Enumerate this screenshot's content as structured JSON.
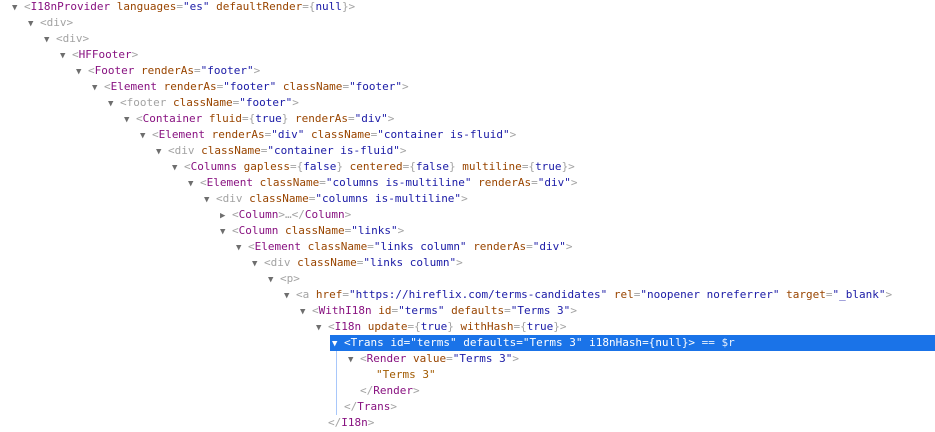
{
  "tree": {
    "rows": [
      {
        "depth": 0,
        "twisty": "▼",
        "parts": [
          [
            "p",
            "<"
          ],
          [
            "tn",
            "I18nProvider"
          ],
          [
            "p",
            " "
          ],
          [
            "an",
            "languages"
          ],
          [
            "p",
            "="
          ],
          [
            "av",
            "\"es\""
          ],
          [
            "p",
            " "
          ],
          [
            "an",
            "defaultRender"
          ],
          [
            "p",
            "={"
          ],
          [
            "av",
            "null"
          ],
          [
            "p",
            "}>"
          ]
        ]
      },
      {
        "depth": 1,
        "twisty": "▼",
        "parts": [
          [
            "p",
            "<div>"
          ]
        ]
      },
      {
        "depth": 2,
        "twisty": "▼",
        "parts": [
          [
            "p",
            "<div>"
          ]
        ]
      },
      {
        "depth": 3,
        "twisty": "▼",
        "parts": [
          [
            "p",
            "<"
          ],
          [
            "tn",
            "HFFooter"
          ],
          [
            "p",
            ">"
          ]
        ]
      },
      {
        "depth": 4,
        "twisty": "▼",
        "parts": [
          [
            "p",
            "<"
          ],
          [
            "tn",
            "Footer"
          ],
          [
            "p",
            " "
          ],
          [
            "an",
            "renderAs"
          ],
          [
            "p",
            "="
          ],
          [
            "av",
            "\"footer\""
          ],
          [
            "p",
            ">"
          ]
        ]
      },
      {
        "depth": 5,
        "twisty": "▼",
        "parts": [
          [
            "p",
            "<"
          ],
          [
            "tn",
            "Element"
          ],
          [
            "p",
            " "
          ],
          [
            "an",
            "renderAs"
          ],
          [
            "p",
            "="
          ],
          [
            "av",
            "\"footer\""
          ],
          [
            "p",
            " "
          ],
          [
            "an",
            "className"
          ],
          [
            "p",
            "="
          ],
          [
            "av",
            "\"footer\""
          ],
          [
            "p",
            ">"
          ]
        ]
      },
      {
        "depth": 6,
        "twisty": "▼",
        "parts": [
          [
            "p",
            "<footer"
          ],
          [
            "p",
            " "
          ],
          [
            "an",
            "className"
          ],
          [
            "p",
            "="
          ],
          [
            "av",
            "\"footer\""
          ],
          [
            "p",
            ">"
          ]
        ]
      },
      {
        "depth": 7,
        "twisty": "▼",
        "parts": [
          [
            "p",
            "<"
          ],
          [
            "tn",
            "Container"
          ],
          [
            "p",
            " "
          ],
          [
            "an",
            "fluid"
          ],
          [
            "p",
            "={"
          ],
          [
            "av",
            "true"
          ],
          [
            "p",
            "} "
          ],
          [
            "an",
            "renderAs"
          ],
          [
            "p",
            "="
          ],
          [
            "av",
            "\"div\""
          ],
          [
            "p",
            ">"
          ]
        ]
      },
      {
        "depth": 8,
        "twisty": "▼",
        "parts": [
          [
            "p",
            "<"
          ],
          [
            "tn",
            "Element"
          ],
          [
            "p",
            " "
          ],
          [
            "an",
            "renderAs"
          ],
          [
            "p",
            "="
          ],
          [
            "av",
            "\"div\""
          ],
          [
            "p",
            " "
          ],
          [
            "an",
            "className"
          ],
          [
            "p",
            "="
          ],
          [
            "av",
            "\"container is-fluid\""
          ],
          [
            "p",
            ">"
          ]
        ]
      },
      {
        "depth": 9,
        "twisty": "▼",
        "parts": [
          [
            "p",
            "<div"
          ],
          [
            "p",
            " "
          ],
          [
            "an",
            "className"
          ],
          [
            "p",
            "="
          ],
          [
            "av",
            "\"container is-fluid\""
          ],
          [
            "p",
            ">"
          ]
        ]
      },
      {
        "depth": 10,
        "twisty": "▼",
        "parts": [
          [
            "p",
            "<"
          ],
          [
            "tn",
            "Columns"
          ],
          [
            "p",
            " "
          ],
          [
            "an",
            "gapless"
          ],
          [
            "p",
            "={"
          ],
          [
            "av",
            "false"
          ],
          [
            "p",
            "} "
          ],
          [
            "an",
            "centered"
          ],
          [
            "p",
            "={"
          ],
          [
            "av",
            "false"
          ],
          [
            "p",
            "} "
          ],
          [
            "an",
            "multiline"
          ],
          [
            "p",
            "={"
          ],
          [
            "av",
            "true"
          ],
          [
            "p",
            "}>"
          ]
        ]
      },
      {
        "depth": 11,
        "twisty": "▼",
        "parts": [
          [
            "p",
            "<"
          ],
          [
            "tn",
            "Element"
          ],
          [
            "p",
            " "
          ],
          [
            "an",
            "className"
          ],
          [
            "p",
            "="
          ],
          [
            "av",
            "\"columns is-multiline\""
          ],
          [
            "p",
            " "
          ],
          [
            "an",
            "renderAs"
          ],
          [
            "p",
            "="
          ],
          [
            "av",
            "\"div\""
          ],
          [
            "p",
            ">"
          ]
        ]
      },
      {
        "depth": 12,
        "twisty": "▼",
        "parts": [
          [
            "p",
            "<div"
          ],
          [
            "p",
            " "
          ],
          [
            "an",
            "className"
          ],
          [
            "p",
            "="
          ],
          [
            "av",
            "\"columns is-multiline\""
          ],
          [
            "p",
            ">"
          ]
        ]
      },
      {
        "depth": 13,
        "twisty": "▶",
        "parts": [
          [
            "p",
            "<"
          ],
          [
            "tn",
            "Column"
          ],
          [
            "p",
            ">…</"
          ],
          [
            "tn",
            "Column"
          ],
          [
            "p",
            ">"
          ]
        ]
      },
      {
        "depth": 13,
        "twisty": "▼",
        "parts": [
          [
            "p",
            "<"
          ],
          [
            "tn",
            "Column"
          ],
          [
            "p",
            " "
          ],
          [
            "an",
            "className"
          ],
          [
            "p",
            "="
          ],
          [
            "av",
            "\"links\""
          ],
          [
            "p",
            ">"
          ]
        ]
      },
      {
        "depth": 14,
        "twisty": "▼",
        "parts": [
          [
            "p",
            "<"
          ],
          [
            "tn",
            "Element"
          ],
          [
            "p",
            " "
          ],
          [
            "an",
            "className"
          ],
          [
            "p",
            "="
          ],
          [
            "av",
            "\"links column\""
          ],
          [
            "p",
            " "
          ],
          [
            "an",
            "renderAs"
          ],
          [
            "p",
            "="
          ],
          [
            "av",
            "\"div\""
          ],
          [
            "p",
            ">"
          ]
        ]
      },
      {
        "depth": 15,
        "twisty": "▼",
        "parts": [
          [
            "p",
            "<div"
          ],
          [
            "p",
            " "
          ],
          [
            "an",
            "className"
          ],
          [
            "p",
            "="
          ],
          [
            "av",
            "\"links column\""
          ],
          [
            "p",
            ">"
          ]
        ]
      },
      {
        "depth": 16,
        "twisty": "▼",
        "parts": [
          [
            "p",
            "<p>"
          ]
        ]
      },
      {
        "depth": 17,
        "twisty": "▼",
        "parts": [
          [
            "p",
            "<a"
          ],
          [
            "p",
            " "
          ],
          [
            "an",
            "href"
          ],
          [
            "p",
            "="
          ],
          [
            "av",
            "\"https://hireflix.com/terms-candidates\""
          ],
          [
            "p",
            " "
          ],
          [
            "an",
            "rel"
          ],
          [
            "p",
            "="
          ],
          [
            "av",
            "\"noopener noreferrer\""
          ],
          [
            "p",
            " "
          ],
          [
            "an",
            "target"
          ],
          [
            "p",
            "="
          ],
          [
            "av",
            "\"_blank\""
          ],
          [
            "p",
            ">"
          ]
        ]
      },
      {
        "depth": 18,
        "twisty": "▼",
        "parts": [
          [
            "p",
            "<"
          ],
          [
            "tn",
            "WithI18n"
          ],
          [
            "p",
            " "
          ],
          [
            "an",
            "id"
          ],
          [
            "p",
            "="
          ],
          [
            "av",
            "\"terms\""
          ],
          [
            "p",
            " "
          ],
          [
            "an",
            "defaults"
          ],
          [
            "p",
            "="
          ],
          [
            "av",
            "\"Terms 3\""
          ],
          [
            "p",
            ">"
          ]
        ]
      },
      {
        "depth": 19,
        "twisty": "▼",
        "parts": [
          [
            "p",
            "<"
          ],
          [
            "tn",
            "I18n"
          ],
          [
            "p",
            " "
          ],
          [
            "an",
            "update"
          ],
          [
            "p",
            "={"
          ],
          [
            "av",
            "true"
          ],
          [
            "p",
            "} "
          ],
          [
            "an",
            "withHash"
          ],
          [
            "p",
            "={"
          ],
          [
            "av",
            "true"
          ],
          [
            "p",
            "}>"
          ]
        ]
      },
      {
        "depth": 20,
        "twisty": "▼",
        "selected": true,
        "parts": [
          [
            "p",
            "<"
          ],
          [
            "tn",
            "Trans"
          ],
          [
            "p",
            " "
          ],
          [
            "an",
            "id"
          ],
          [
            "p",
            "="
          ],
          [
            "av",
            "\"terms\""
          ],
          [
            "p",
            " "
          ],
          [
            "an",
            "defaults"
          ],
          [
            "p",
            "="
          ],
          [
            "av",
            "\"Terms 3\""
          ],
          [
            "p",
            " "
          ],
          [
            "an",
            "i18nHash"
          ],
          [
            "p",
            "={"
          ],
          [
            "av",
            "null"
          ],
          [
            "p",
            "}>"
          ]
        ],
        "tail": " == $r"
      },
      {
        "depth": 21,
        "twisty": "▼",
        "parts": [
          [
            "p",
            "<"
          ],
          [
            "tn",
            "Render"
          ],
          [
            "p",
            " "
          ],
          [
            "an",
            "value"
          ],
          [
            "p",
            "="
          ],
          [
            "av",
            "\"Terms 3\""
          ],
          [
            "p",
            ">"
          ]
        ]
      },
      {
        "depth": 22,
        "twisty": "",
        "parts": [
          [
            "tx",
            "\"Terms 3\""
          ]
        ]
      },
      {
        "depth": 21,
        "twisty": "",
        "parts": [
          [
            "p",
            "</"
          ],
          [
            "tn",
            "Render"
          ],
          [
            "p",
            ">"
          ]
        ]
      },
      {
        "depth": 20,
        "twisty": "",
        "parts": [
          [
            "p",
            "</"
          ],
          [
            "tn",
            "Trans"
          ],
          [
            "p",
            ">"
          ]
        ]
      },
      {
        "depth": 19,
        "twisty": "",
        "parts": [
          [
            "p",
            "</"
          ],
          [
            "tn",
            "I18n"
          ],
          [
            "p",
            ">"
          ]
        ]
      }
    ]
  }
}
